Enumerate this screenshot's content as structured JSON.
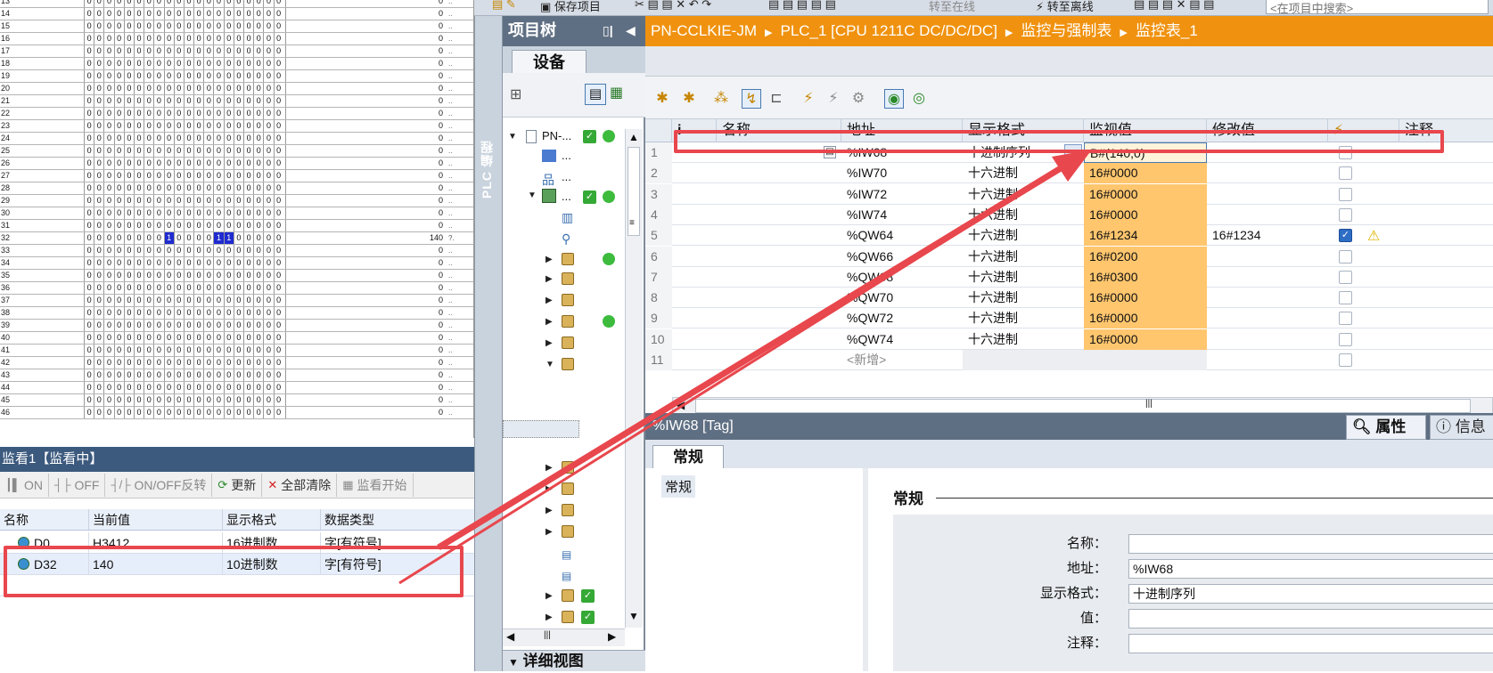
{
  "memory_grid": {
    "rows": [
      {
        "num": "13",
        "value": "0"
      },
      {
        "num": "14",
        "value": "0"
      },
      {
        "num": "15",
        "value": "0"
      },
      {
        "num": "16",
        "value": "0"
      },
      {
        "num": "17",
        "value": "0"
      },
      {
        "num": "18",
        "value": "0"
      },
      {
        "num": "19",
        "value": "0"
      },
      {
        "num": "20",
        "value": "0"
      },
      {
        "num": "21",
        "value": "0"
      },
      {
        "num": "22",
        "value": "0"
      },
      {
        "num": "23",
        "value": "0"
      },
      {
        "num": "24",
        "value": "0"
      },
      {
        "num": "25",
        "value": "0"
      },
      {
        "num": "26",
        "value": "0"
      },
      {
        "num": "27",
        "value": "0"
      },
      {
        "num": "28",
        "value": "0"
      },
      {
        "num": "29",
        "value": "0"
      },
      {
        "num": "30",
        "value": "0"
      },
      {
        "num": "31",
        "value": "0"
      },
      {
        "num": "32",
        "value": "140"
      },
      {
        "num": "33",
        "value": "0"
      },
      {
        "num": "34",
        "value": "0"
      },
      {
        "num": "35",
        "value": "0"
      },
      {
        "num": "36",
        "value": "0"
      },
      {
        "num": "37",
        "value": "0"
      },
      {
        "num": "38",
        "value": "0"
      },
      {
        "num": "39",
        "value": "0"
      },
      {
        "num": "40",
        "value": "0"
      },
      {
        "num": "41",
        "value": "0"
      },
      {
        "num": "42",
        "value": "0"
      },
      {
        "num": "43",
        "value": "0"
      },
      {
        "num": "44",
        "value": "0"
      },
      {
        "num": "45",
        "value": "0"
      },
      {
        "num": "46",
        "value": "0"
      }
    ],
    "bits_default": "0",
    "bits_row32": [
      "0",
      "0",
      "0",
      "0",
      "0",
      "0",
      "0",
      "0",
      "1",
      "0",
      "0",
      "0",
      "0",
      "1",
      "1",
      "0",
      "0",
      "0",
      "0",
      "0"
    ],
    "row32_suffix": "?."
  },
  "monitor": {
    "title": "监看1【监看中】",
    "toolbar": {
      "on": "ON",
      "off": "OFF",
      "toggle": "ON/OFF反转",
      "refresh": "更新",
      "clear_all": "全部清除",
      "start": "监看开始"
    },
    "headers": [
      "名称",
      "当前值",
      "显示格式",
      "数据类型"
    ],
    "rows": [
      {
        "name": "D0",
        "value": "H3412",
        "format": "16进制数",
        "type": "字[有符号]"
      },
      {
        "name": "D32",
        "value": "140",
        "format": "10进制数",
        "type": "字[有符号]"
      }
    ]
  },
  "top_toolbar": {
    "save": "保存项目",
    "go_online": "转至在线",
    "go_offline": "转至离线",
    "search_placeholder": "<在项目中搜索>"
  },
  "divider_label": "PLC 编程",
  "project_tree": {
    "title": "项目树",
    "tab": "设备",
    "root": "PN-...",
    "dots": "...",
    "detail_view": "详细视图"
  },
  "breadcrumb": [
    "PN-CCLKIE-JM",
    "PLC_1 [CPU 1211C DC/DC/DC]",
    "监控与强制表",
    "监控表_1"
  ],
  "watch_table": {
    "headers": {
      "info": "i",
      "name": "名称",
      "address": "地址",
      "format": "显示格式",
      "monitor": "监视值",
      "modify": "修改值",
      "force": "⚡",
      "comment": "注释"
    },
    "rows": [
      {
        "n": "1",
        "address": "%IW68",
        "format": "十进制序列",
        "monitor": "B#(140,0)",
        "modify": "",
        "checked": false,
        "warn": false
      },
      {
        "n": "2",
        "address": "%IW70",
        "format": "十六进制",
        "monitor": "16#0000",
        "modify": "",
        "checked": false,
        "warn": false
      },
      {
        "n": "3",
        "address": "%IW72",
        "format": "十六进制",
        "monitor": "16#0000",
        "modify": "",
        "checked": false,
        "warn": false
      },
      {
        "n": "4",
        "address": "%IW74",
        "format": "十六进制",
        "monitor": "16#0000",
        "modify": "",
        "checked": false,
        "warn": false
      },
      {
        "n": "5",
        "address": "%QW64",
        "format": "十六进制",
        "monitor": "16#1234",
        "modify": "16#1234",
        "checked": true,
        "warn": true
      },
      {
        "n": "6",
        "address": "%QW66",
        "format": "十六进制",
        "monitor": "16#0200",
        "modify": "",
        "checked": false,
        "warn": false
      },
      {
        "n": "7",
        "address": "%QW68",
        "format": "十六进制",
        "monitor": "16#0300",
        "modify": "",
        "checked": false,
        "warn": false
      },
      {
        "n": "8",
        "address": "%QW70",
        "format": "十六进制",
        "monitor": "16#0000",
        "modify": "",
        "checked": false,
        "warn": false
      },
      {
        "n": "9",
        "address": "%QW72",
        "format": "十六进制",
        "monitor": "16#0000",
        "modify": "",
        "checked": false,
        "warn": false
      },
      {
        "n": "10",
        "address": "%QW74",
        "format": "十六进制",
        "monitor": "16#0000",
        "modify": "",
        "checked": false,
        "warn": false
      },
      {
        "n": "11",
        "address": "<新增>",
        "format": "",
        "monitor": "",
        "modify": "",
        "checked": false,
        "warn": false
      }
    ]
  },
  "properties": {
    "bar_title": "%IW68 [Tag]",
    "tab_properties": "属性",
    "tab_info": "信息",
    "general_tab": "常规",
    "left_item": "常规",
    "section": "常规",
    "fields": [
      {
        "label": "名称：",
        "value": ""
      },
      {
        "label": "地址：",
        "value": "%IW68"
      },
      {
        "label": "显示格式：",
        "value": "十进制序列"
      },
      {
        "label": "值：",
        "value": ""
      },
      {
        "label": "注释：",
        "value": ""
      }
    ]
  },
  "colors": {
    "accent_orange": "#f0920f",
    "monitor_cell": "#ffc66e",
    "annotation_red": "#e8474d",
    "header_blue": "#3c5a7e"
  }
}
